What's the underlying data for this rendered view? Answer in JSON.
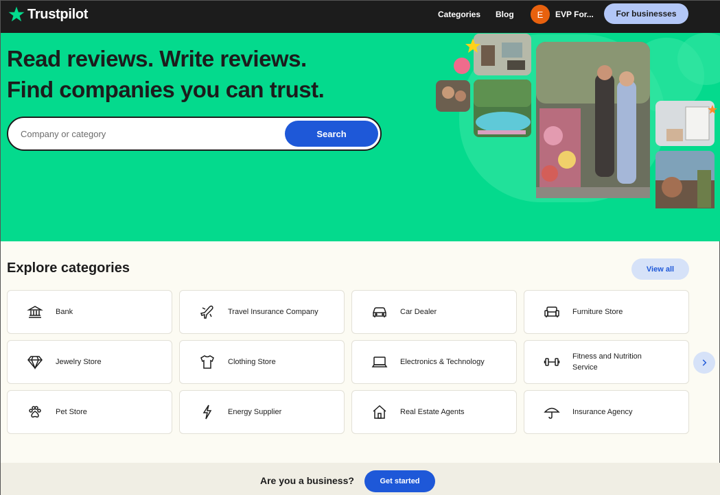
{
  "brand": {
    "name": "Trustpilot",
    "accent": "#04da8d",
    "primary_button": "#1e58d8"
  },
  "header": {
    "nav": [
      {
        "label": "Categories"
      },
      {
        "label": "Blog"
      }
    ],
    "user": {
      "initial": "E",
      "name": "EVP For..."
    },
    "business_button": "For businesses"
  },
  "hero": {
    "title_line1": "Read reviews. Write reviews.",
    "title_line2": "Find companies you can trust.",
    "search": {
      "placeholder": "Company or category",
      "button": "Search"
    }
  },
  "categories": {
    "title": "Explore categories",
    "view_all": "View all",
    "items": [
      {
        "label": "Bank",
        "icon": "bank-icon"
      },
      {
        "label": "Travel Insurance Company",
        "icon": "airplane-icon"
      },
      {
        "label": "Car Dealer",
        "icon": "car-icon"
      },
      {
        "label": "Furniture Store",
        "icon": "sofa-icon"
      },
      {
        "label": "Jewelry Store",
        "icon": "diamond-icon"
      },
      {
        "label": "Clothing Store",
        "icon": "shirt-icon"
      },
      {
        "label": "Electronics & Technology",
        "icon": "laptop-icon"
      },
      {
        "label": "Fitness and Nutrition Service",
        "icon": "dumbbell-icon"
      },
      {
        "label": "Pet Store",
        "icon": "paw-icon"
      },
      {
        "label": "Energy Supplier",
        "icon": "lightning-icon"
      },
      {
        "label": "Real Estate Agents",
        "icon": "house-icon"
      },
      {
        "label": "Insurance Agency",
        "icon": "umbrella-icon"
      }
    ],
    "next_icon": "chevron-right-icon"
  },
  "business_band": {
    "question": "Are you a business?",
    "button": "Get started"
  }
}
